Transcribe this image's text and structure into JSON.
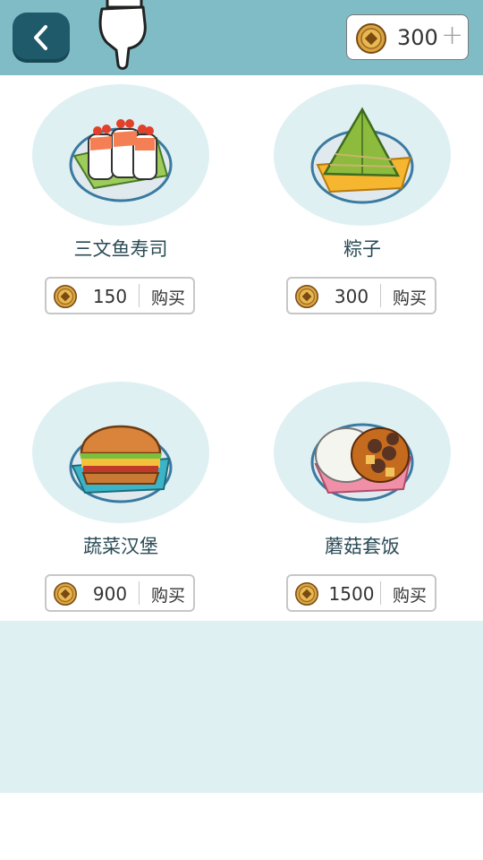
{
  "header": {
    "back_icon": "chevron-left-icon",
    "pointer_icon": "pointing-hand-icon",
    "coins": "300",
    "plus_label": "+"
  },
  "items": [
    {
      "name": "三文鱼寿司",
      "price": "150",
      "buy_label": "购买",
      "icon": "salmon-sushi-icon"
    },
    {
      "name": "粽子",
      "price": "300",
      "buy_label": "购买",
      "icon": "zongzi-icon"
    },
    {
      "name": "蔬菜汉堡",
      "price": "900",
      "buy_label": "购买",
      "icon": "veggie-burger-icon"
    },
    {
      "name": "蘑菇套饭",
      "price": "1500",
      "buy_label": "购买",
      "icon": "mushroom-rice-icon"
    }
  ],
  "colors": {
    "header_bg": "#7fbcc6",
    "back_button": "#1f5a6a",
    "plate_bg": "#dff0f3",
    "coin": "#d9a441"
  }
}
